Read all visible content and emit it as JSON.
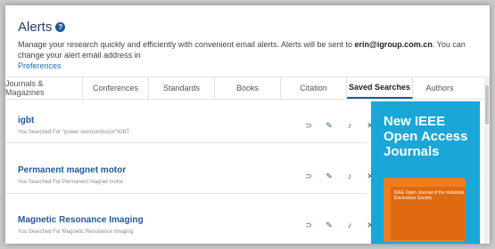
{
  "header": {
    "title": "Alerts",
    "help_icon": "?",
    "description_prefix": "Manage your research quickly and efficiently with convenient email alerts. Alerts will be sent to ",
    "email": "erin@igroup.com.cn",
    "description_suffix": ". You can change your alert email address in",
    "preferences_link": "Preferences"
  },
  "tabs": [
    {
      "label": "Journals & Magazines",
      "active": false
    },
    {
      "label": "Conferences",
      "active": false
    },
    {
      "label": "Standards",
      "active": false
    },
    {
      "label": "Books",
      "active": false
    },
    {
      "label": "Citation",
      "active": false
    },
    {
      "label": "Saved Searches",
      "active": true
    },
    {
      "label": "Authors",
      "active": false
    }
  ],
  "saved_searches": [
    {
      "title": "igbt",
      "subtitle": "You Searched For \"power semiconductor\"IGBT"
    },
    {
      "title": "Permanent magnet motor",
      "subtitle": "You Searched For Permanent magnet motor"
    },
    {
      "title": "Magnetic Resonance Imaging",
      "subtitle": "You Searched For Magnetic Resonance Imaging"
    }
  ],
  "ad": {
    "title": "New IEEE\nOpen Access\nJournals",
    "magazine_title": "IEEE Open Journal of the\nIndustrial Electronics Society"
  },
  "colors": {
    "accent": "#1f5a99",
    "ad_background": "#1aa7d7",
    "magazine": "#f07d1f"
  }
}
